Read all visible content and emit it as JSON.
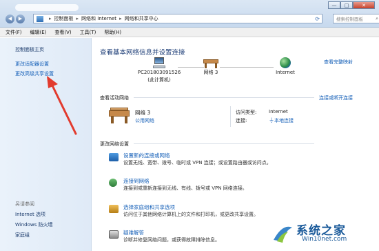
{
  "window": {
    "breadcrumb": [
      "控制面板",
      "网络和 Internet",
      "网络和共享中心"
    ],
    "search_placeholder": "搜索控制面板",
    "buttons": {
      "minimize": "—",
      "maximize": "□",
      "close": "✕"
    }
  },
  "menu": [
    "文件(F)",
    "编辑(E)",
    "查看(V)",
    "工具(T)",
    "帮助(H)"
  ],
  "sidebar": {
    "home": "控制面板主页",
    "items": [
      "更改适配器设置",
      "更改高级共享设置"
    ],
    "see_also_title": "另请参阅",
    "see_also": [
      "Internet 选项",
      "Windows 防火墙",
      "家庭组"
    ]
  },
  "main": {
    "title": "查看基本网络信息并设置连接",
    "view_full_map": "查看完整映射",
    "map": {
      "pc_name": "PC201803091526",
      "pc_sub": "(此计算机)",
      "network": "网络  3",
      "internet": "Internet"
    },
    "active_title": "查看活动网络",
    "connect_disconnect": "连接或断开连接",
    "active_net": {
      "name": "网络  3",
      "type": "公用网络",
      "access_label": "访问类型:",
      "access_value": "Internet",
      "conn_label": "连接:",
      "conn_value": "本地连接"
    },
    "change_title": "更改网络设置",
    "tasks": [
      {
        "title": "设置新的连接或网络",
        "desc": "设置无线、宽带、拨号、临时或 VPN 连接；或设置路由器或访问点。"
      },
      {
        "title": "连接到网络",
        "desc": "连接到或重新连接到无线、有线、拨号或 VPN 网络连接。"
      },
      {
        "title": "选择家庭组和共享选项",
        "desc": "访问位于其他网络计算机上的文件和打印机，或更改共享设置。"
      },
      {
        "title": "疑难解答",
        "desc": "诊断并修复网络问题，或获得故障排除信息。"
      }
    ]
  },
  "watermark": {
    "brand": "系统之家",
    "url": "Win10net.com"
  },
  "colors": {
    "link": "#1660b8",
    "heading": "#1f3f78",
    "arrow": "#e23b2e",
    "sidebar_bg": "#e3eef9"
  }
}
